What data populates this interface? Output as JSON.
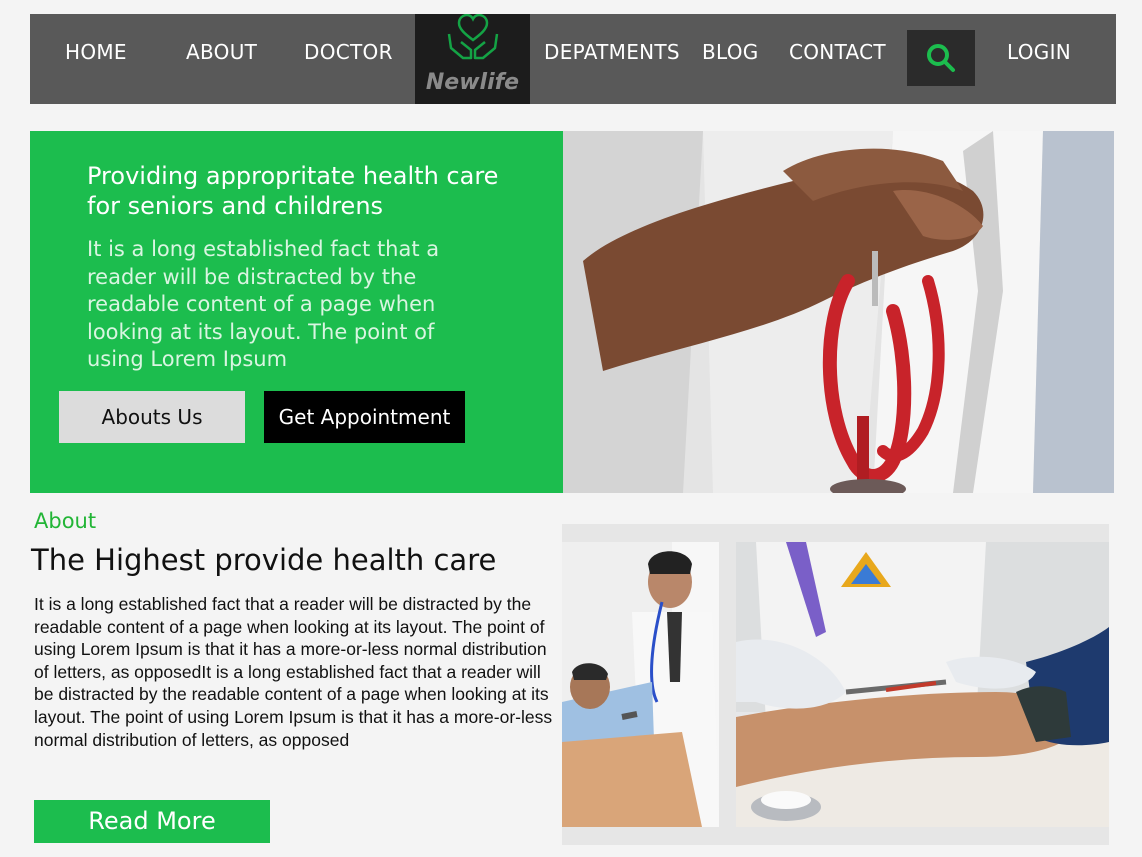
{
  "nav": {
    "items": [
      "HOME",
      "ABOUT",
      "DOCTOR",
      "DEPATMENTS",
      "BLOG",
      "CONTACT"
    ],
    "login": "LOGIN",
    "logo_text": "Newlife",
    "logo_icon": "heart-hands-icon",
    "search_icon": "search-icon"
  },
  "hero": {
    "title": "Providing appropritate  health care for seniors and childrens",
    "description": "It is a long established fact that a reader will be distracted by the readable content of a page when looking at its layout. The point of using Lorem Ipsum",
    "about_button": "Abouts Us",
    "appointment_button": "Get Appointment"
  },
  "about": {
    "kicker": "About",
    "heading": "The Highest provide health care",
    "body": "It is a long established fact that a reader will be distracted by the readable content of a page when looking at its layout. The point of using Lorem Ipsum is that it has a more-or-less normal distribution of letters, as opposedIt is a long established fact that a reader will be distracted by the readable content of a page when looking at its layout. The point of using Lorem Ipsum is that it has a more-or-less normal distribution of letters, as opposed",
    "read_more": "Read More"
  },
  "colors": {
    "accent_green": "#1cbd4e",
    "nav_bg": "#595959",
    "logo_bg": "#1c1c1c"
  }
}
